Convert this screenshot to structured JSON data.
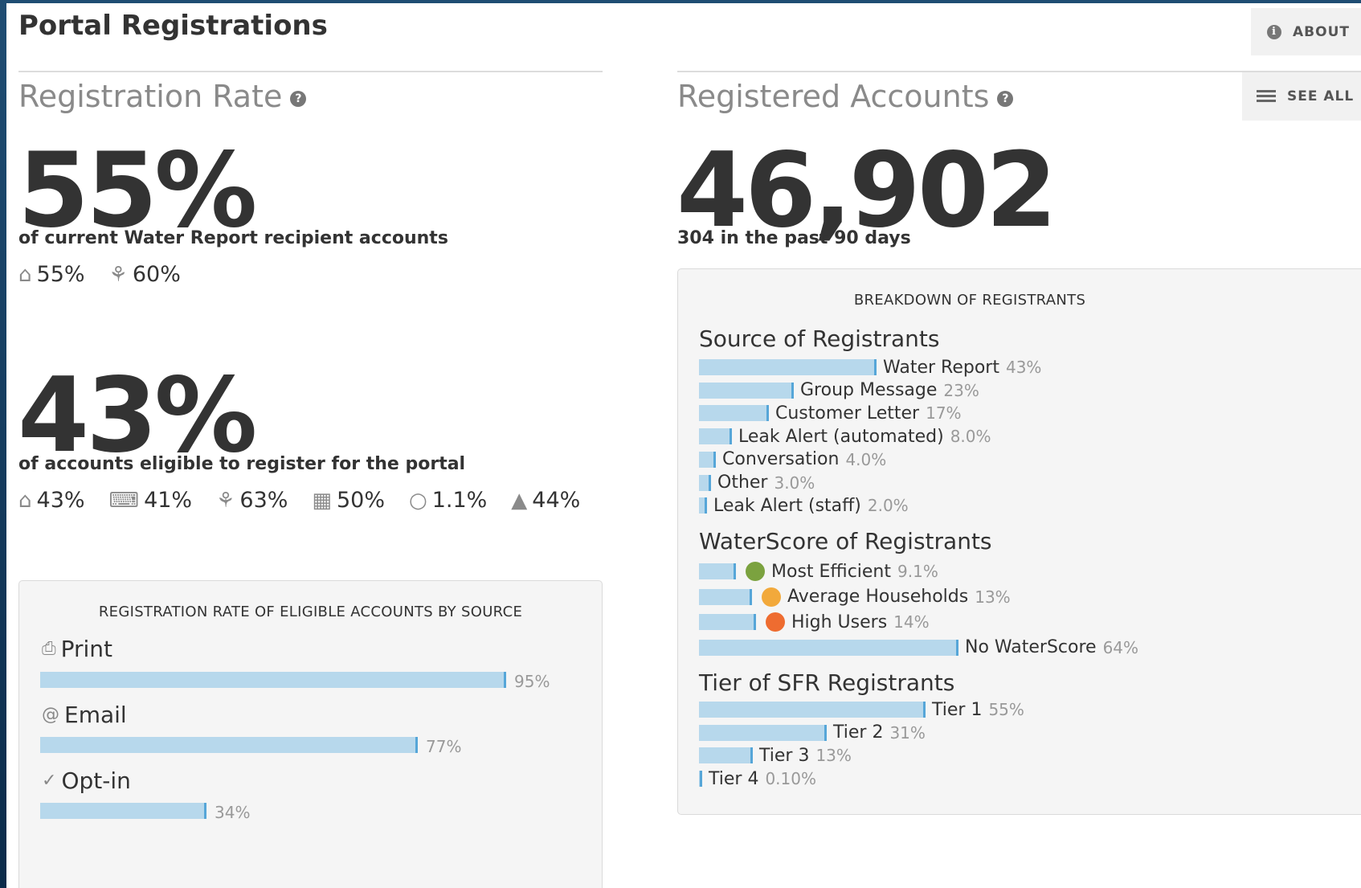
{
  "header": {
    "title": "Portal Registrations",
    "about_label": "ABOUT"
  },
  "registration_rate": {
    "title": "Registration Rate",
    "metric1": {
      "value": "55%",
      "caption": "of current Water Report recipient accounts",
      "breakdown": [
        {
          "icon": "house-icon",
          "value": "55%"
        },
        {
          "icon": "sprinkler-icon",
          "value": "60%"
        }
      ]
    },
    "metric2": {
      "value": "43%",
      "caption": "of accounts eligible to register for the portal",
      "breakdown": [
        {
          "icon": "house-icon",
          "value": "43%"
        },
        {
          "icon": "register-icon",
          "value": "41%"
        },
        {
          "icon": "sprinkler-icon",
          "value": "63%"
        },
        {
          "icon": "building-icon",
          "value": "50%"
        },
        {
          "icon": "fire-icon",
          "value": "1.1%"
        },
        {
          "icon": "drop-icon",
          "value": "44%"
        }
      ]
    },
    "by_source": {
      "heading": "REGISTRATION RATE OF ELIGIBLE ACCOUNTS BY SOURCE",
      "items": [
        {
          "label": "Print",
          "icon": "print-icon",
          "percent_label": "95%",
          "fraction": 0.95
        },
        {
          "label": "Email",
          "icon": "email-icon",
          "percent_label": "77%",
          "fraction": 0.77
        },
        {
          "label": "Opt-in",
          "icon": "check-icon",
          "percent_label": "34%",
          "fraction": 0.34
        }
      ]
    }
  },
  "registered_accounts": {
    "title": "Registered Accounts",
    "see_all_label": "SEE ALL",
    "count": "46,902",
    "caption": "304 in the past 90 days",
    "breakdown": {
      "heading": "BREAKDOWN OF REGISTRANTS",
      "source": {
        "title": "Source of Registrants",
        "items": [
          {
            "label": "Water Report",
            "percent": "43%",
            "value": 43
          },
          {
            "label": "Group Message",
            "percent": "23%",
            "value": 23
          },
          {
            "label": "Customer Letter",
            "percent": "17%",
            "value": 17
          },
          {
            "label": "Leak Alert (automated)",
            "percent": "8.0%",
            "value": 8
          },
          {
            "label": "Conversation",
            "percent": "4.0%",
            "value": 4
          },
          {
            "label": "Other",
            "percent": "3.0%",
            "value": 3
          },
          {
            "label": "Leak Alert (staff)",
            "percent": "2.0%",
            "value": 2
          }
        ]
      },
      "waterscore": {
        "title": "WaterScore of Registrants",
        "items": [
          {
            "label": "Most Efficient",
            "percent": "9.1%",
            "value": 9.1,
            "dot_color": "#7ba23f"
          },
          {
            "label": "Average Households",
            "percent": "13%",
            "value": 13,
            "dot_color": "#f2a93b"
          },
          {
            "label": "High Users",
            "percent": "14%",
            "value": 14,
            "dot_color": "#ee6c30"
          },
          {
            "label": "No WaterScore",
            "percent": "64%",
            "value": 64
          }
        ]
      },
      "tier": {
        "title": "Tier of SFR Registrants",
        "items": [
          {
            "label": "Tier 1",
            "percent": "55%",
            "value": 55
          },
          {
            "label": "Tier 2",
            "percent": "31%",
            "value": 31
          },
          {
            "label": "Tier 3",
            "percent": "13%",
            "value": 13
          },
          {
            "label": "Tier 4",
            "percent": "0.10%",
            "value": 0.1
          }
        ]
      }
    }
  },
  "colors": {
    "bar_fill": "#b7d8ec",
    "bar_edge": "#56a6d8",
    "heading_gray": "#8a8a8a",
    "text_dark": "#333333"
  }
}
